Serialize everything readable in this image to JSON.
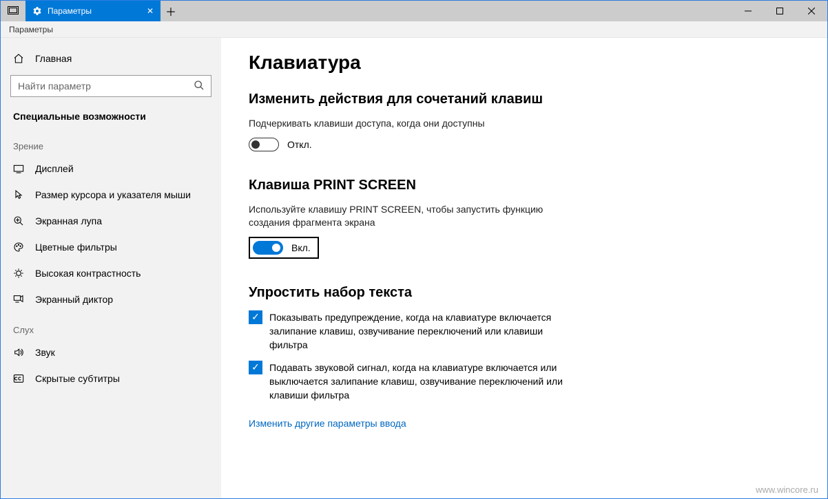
{
  "titlebar": {
    "tab_title": "Параметры",
    "app_label": "Параметры"
  },
  "sidebar": {
    "home_label": "Главная",
    "search_placeholder": "Найти параметр",
    "section_heading": "Специальные возможности",
    "group_vision": "Зрение",
    "items_vision": [
      "Дисплей",
      "Размер курсора и указателя мыши",
      "Экранная лупа",
      "Цветные фильтры",
      "Высокая контрастность",
      "Экранный диктор"
    ],
    "group_hearing": "Слух",
    "items_hearing": [
      "Звук",
      "Скрытые субтитры"
    ]
  },
  "main": {
    "page_title": "Клавиатура",
    "section1_title": "Изменить действия для сочетаний клавиш",
    "section1_desc": "Подчеркивать клавиши доступа, когда они доступны",
    "toggle_off": "Откл.",
    "section2_title": "Клавиша PRINT SCREEN",
    "section2_desc": "Используйте клавишу PRINT SCREEN, чтобы запустить функцию создания фрагмента экрана",
    "toggle_on": "Вкл.",
    "section3_title": "Упростить набор текста",
    "check1": "Показывать предупреждение, когда на клавиатуре включается залипание клавиш, озвучивание переключений или клавиши фильтра",
    "check2": "Подавать звуковой сигнал, когда на клавиатуре включается или выключается залипание клавиш, озвучивание переключений или клавиши фильтра",
    "link_more": "Изменить другие параметры ввода"
  },
  "watermark": "www.wincore.ru"
}
